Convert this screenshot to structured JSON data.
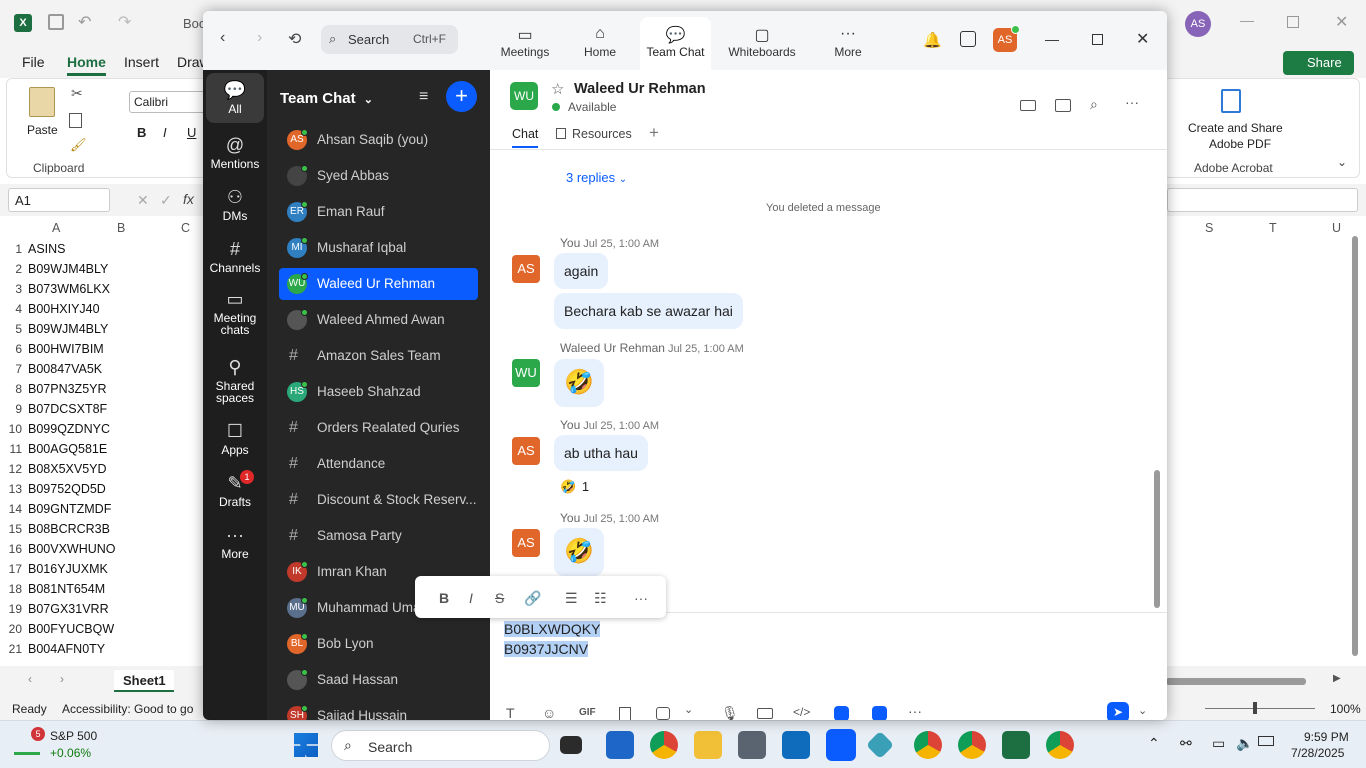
{
  "excel": {
    "title_fragment": "Boo",
    "menu_tabs": [
      "File",
      "Home",
      "Insert",
      "Draw"
    ],
    "share_label": "Share",
    "paste_label": "Paste",
    "clipboard_label": "Clipboard",
    "font_name": "Calibri",
    "adobe_create": "Create and Share",
    "adobe_pdf": "Adobe PDF",
    "adobe_group": "Adobe Acrobat",
    "name_box": "A1",
    "fx": "fx",
    "col_headers_left": [
      "A",
      "B",
      "C"
    ],
    "col_headers_right": [
      "S",
      "T",
      "U"
    ],
    "rows": [
      "ASINS",
      "B09WJM4BLY",
      "B073WM6LKX",
      "B00HXIYJ40",
      "B09WJM4BLY",
      "B00HWI7BIM",
      "B00847VA5K",
      "B07PN3Z5YR",
      "B07DCSXT8F",
      "B099QZDNYC",
      "B00AGQ581E",
      "B08X5XV5YD",
      "B09752QD5D",
      "B09GNTZMDF",
      "B08BCRCR3B",
      "B00VXWHUNO",
      "B016YJUXMK",
      "B081NT654M",
      "B07GX31VRR",
      "B00FYUCBQW",
      "B004AFN0TY"
    ],
    "sheet_tab": "Sheet1",
    "status_ready": "Ready",
    "status_accessibility": "Accessibility: Good to go",
    "zoom_level": "100%"
  },
  "zoom_app": {
    "search_placeholder": "Search",
    "search_shortcut": "Ctrl+F",
    "nav_tabs": [
      {
        "label": "Meetings",
        "icon": "video-icon"
      },
      {
        "label": "Home",
        "icon": "home-icon"
      },
      {
        "label": "Team Chat",
        "icon": "chat-icon"
      },
      {
        "label": "Whiteboards",
        "icon": "whiteboard-icon"
      },
      {
        "label": "More",
        "icon": "more-icon"
      }
    ],
    "user_initials": "AS",
    "rail": [
      {
        "label": "All",
        "icon": "chat-bubble-icon"
      },
      {
        "label": "Mentions",
        "icon": "at-icon"
      },
      {
        "label": "DMs",
        "icon": "people-icon"
      },
      {
        "label": "Channels",
        "icon": "hash-icon"
      },
      {
        "label": "Meeting chats",
        "icon": "calendar-icon"
      },
      {
        "label": "Shared spaces",
        "icon": "shared-icon"
      },
      {
        "label": "Apps",
        "icon": "apps-icon"
      },
      {
        "label": "Drafts",
        "icon": "drafts-icon",
        "badge": "1"
      },
      {
        "label": "More",
        "icon": "more-icon"
      }
    ],
    "list_title": "Team Chat",
    "contacts": [
      {
        "name": "Ahsan Saqib (you)",
        "initials": "AS",
        "type": "user",
        "color": "#e1662a"
      },
      {
        "name": "Syed Abbas",
        "initials": "",
        "type": "user",
        "color": "#444"
      },
      {
        "name": "Eman Rauf",
        "initials": "ER",
        "type": "user",
        "color": "#2f7fc1"
      },
      {
        "name": "Musharaf Iqbal",
        "initials": "MI",
        "type": "user",
        "color": "#2f7fc1"
      },
      {
        "name": "Waleed Ur Rehman",
        "initials": "WU",
        "type": "user",
        "color": "#2aa84a"
      },
      {
        "name": "Waleed Ahmed Awan",
        "initials": "",
        "type": "user",
        "color": "#555"
      },
      {
        "name": "Amazon Sales Team",
        "initials": "",
        "type": "channel",
        "color": ""
      },
      {
        "name": "Haseeb Shahzad",
        "initials": "HS",
        "type": "user",
        "color": "#2aa87a"
      },
      {
        "name": "Orders Realated Quries",
        "initials": "",
        "type": "channel",
        "color": ""
      },
      {
        "name": "Attendance",
        "initials": "",
        "type": "channel",
        "color": ""
      },
      {
        "name": "Discount & Stock Reserv...",
        "initials": "",
        "type": "channel",
        "color": ""
      },
      {
        "name": "Samosa Party",
        "initials": "",
        "type": "channel",
        "color": ""
      },
      {
        "name": "Imran Khan",
        "initials": "IK",
        "type": "user",
        "color": "#c0392b"
      },
      {
        "name": "Muhammad Uma",
        "initials": "MU",
        "type": "user",
        "color": "#5a6f8c"
      },
      {
        "name": "Bob Lyon",
        "initials": "BL",
        "type": "user",
        "color": "#e1662a"
      },
      {
        "name": "Saad Hassan",
        "initials": "",
        "type": "user",
        "color": "#555"
      },
      {
        "name": "Sajjad Hussain",
        "initials": "SH",
        "type": "user",
        "color": "#c0392b"
      }
    ],
    "chat": {
      "contact_name": "Waleed Ur Rehman",
      "contact_initials": "WU",
      "status": "Available",
      "tabs": [
        "Chat",
        "Resources"
      ],
      "replies": "3 replies",
      "deleted_notice": "You deleted a message",
      "messages": [
        {
          "sender": "You",
          "time": "Jul 25, 1:00 AM",
          "initials": "AS",
          "texts": [
            "again",
            "Bechara kab se awazar hai"
          ]
        },
        {
          "sender": "Waleed Ur Rehman",
          "time": "Jul 25, 1:00 AM",
          "initials": "WU",
          "texts": [
            "🤣"
          ]
        },
        {
          "sender": "You",
          "time": "Jul 25, 1:00 AM",
          "initials": "AS",
          "texts": [
            "ab utha hau"
          ],
          "reaction": "🤣",
          "reaction_count": "1"
        },
        {
          "sender": "You",
          "time": "Jul 25, 1:00 AM",
          "initials": "AS",
          "texts": [
            "🤣"
          ]
        }
      ],
      "compose_lines": [
        "B0BLXWDQKY",
        "B0937JJCNV"
      ]
    }
  },
  "taskbar": {
    "stock_name": "S&P 500",
    "stock_change": "+0.06%",
    "stock_badge": "5",
    "search_label": "Search",
    "time": "9:59 PM",
    "date": "7/28/2025"
  }
}
